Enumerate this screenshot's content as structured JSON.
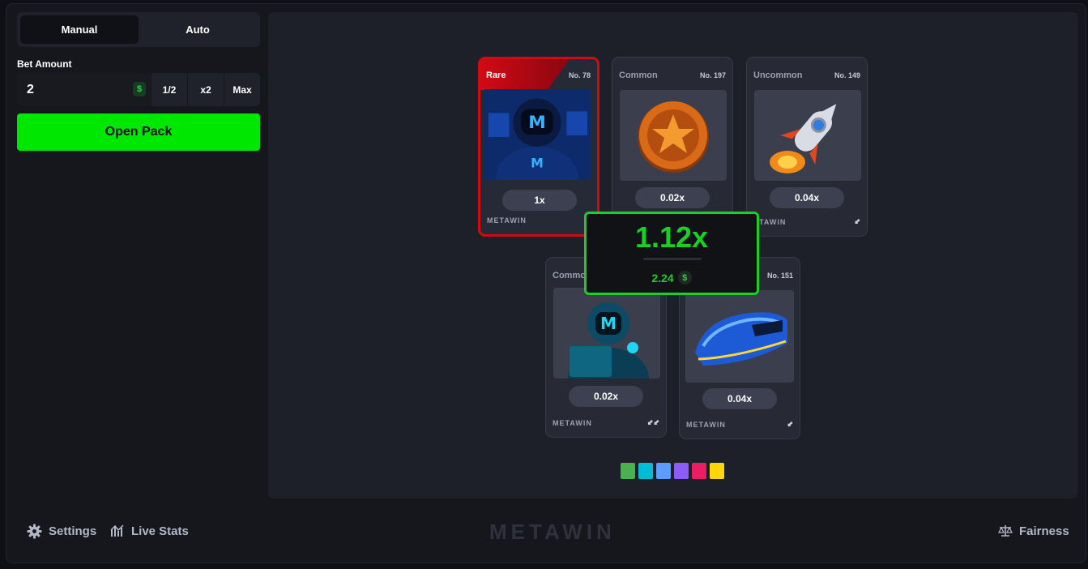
{
  "sidebar": {
    "tabs": [
      {
        "label": "Manual",
        "active": true
      },
      {
        "label": "Auto",
        "active": false
      }
    ],
    "bet_label": "Bet Amount",
    "bet_value": "2",
    "currency_symbol": "$",
    "half_label": "1/2",
    "double_label": "x2",
    "max_label": "Max",
    "open_pack_label": "Open Pack"
  },
  "cards": [
    {
      "rarity": "Rare",
      "number": "No. 78",
      "multiplier": "1x",
      "brand": "METAWIN",
      "art": "hooded-gamer-icon"
    },
    {
      "rarity": "Common",
      "number": "No. 197",
      "multiplier": "0.02x",
      "brand": "",
      "art": "star-coin-icon"
    },
    {
      "rarity": "Uncommon",
      "number": "No. 149",
      "multiplier": "0.04x",
      "brand": "ETAWIN",
      "art": "rocket-icon"
    },
    {
      "rarity": "Commo",
      "number": "",
      "multiplier": "0.02x",
      "brand": "METAWIN",
      "art": "hacker-laptop-icon"
    },
    {
      "rarity": "",
      "number": "No. 151",
      "multiplier": "0.04x",
      "brand": "METAWIN",
      "art": "bullet-train-icon"
    }
  ],
  "result": {
    "multiplier": "1.12x",
    "payout": "2.24",
    "currency_symbol": "$"
  },
  "swatch_colors": [
    "#4caf50",
    "#00bcd4",
    "#5c9dff",
    "#8b5cf6",
    "#e91e63",
    "#ffd60a"
  ],
  "footer": {
    "settings_label": "Settings",
    "live_stats_label": "Live Stats",
    "logo_text": "METAWIN",
    "fairness_label": "Fairness"
  },
  "colors": {
    "accent": "#00e701",
    "rare": "#d10a14",
    "result_green": "#19d024"
  }
}
